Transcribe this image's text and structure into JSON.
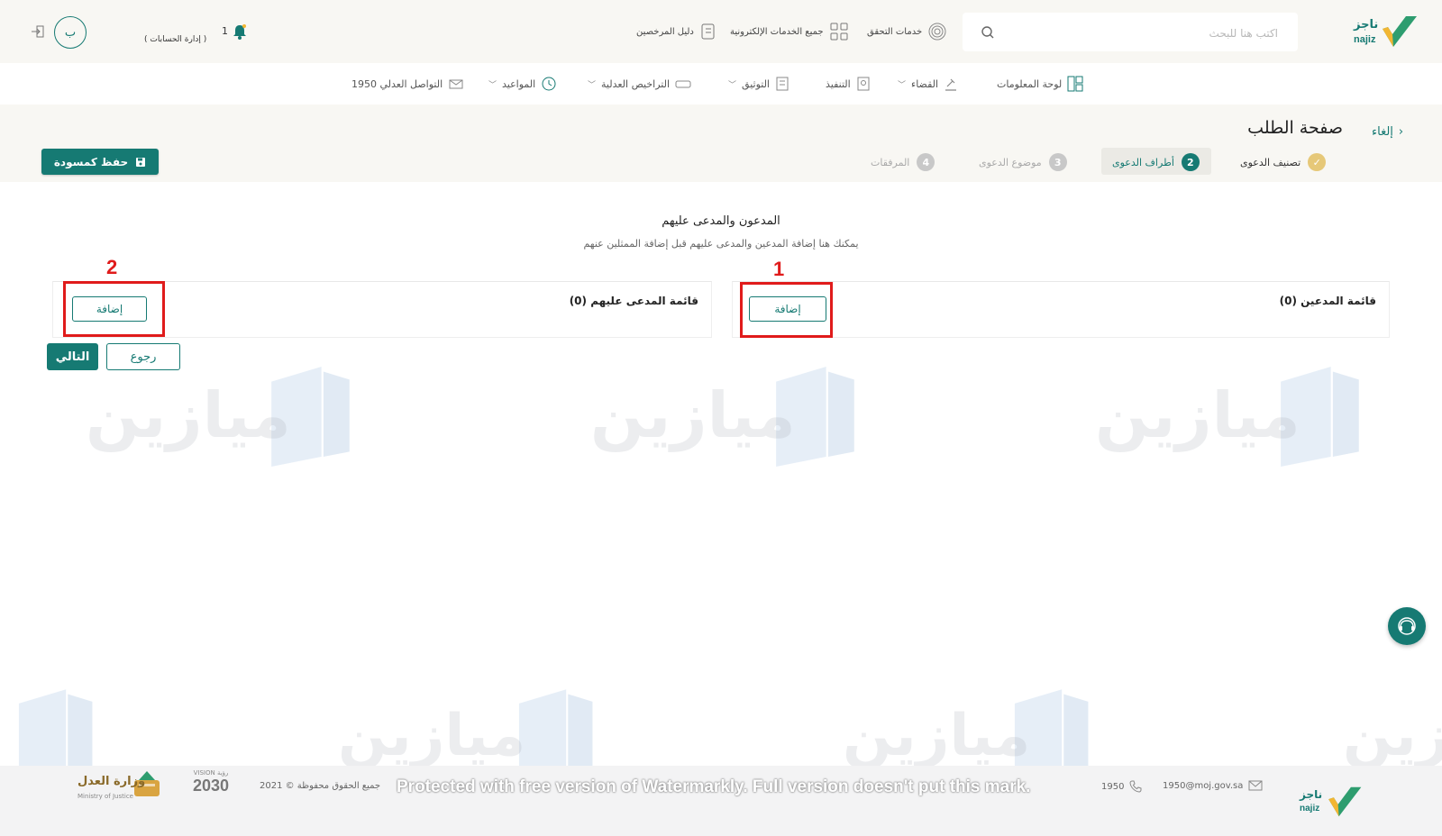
{
  "header": {
    "search_placeholder": "اكتب هنا للبحث",
    "links": [
      {
        "label": "خدمات التحقق",
        "icon": "fingerprint-icon"
      },
      {
        "label": "جميع الخدمات الإلكترونية",
        "icon": "grid-icon"
      },
      {
        "label": "دليل المرخصين",
        "icon": "book-icon"
      }
    ],
    "accounts_label": "( إدارة الحسابات )",
    "notification_count": "1",
    "avatar_initial": "ب",
    "brand": {
      "name": "ناجز",
      "sub": "najiz"
    }
  },
  "nav": [
    {
      "label": "لوحة المعلومات",
      "dropdown": false,
      "icon": "dashboard-icon"
    },
    {
      "label": "القضاء",
      "dropdown": true,
      "icon": "gavel-icon"
    },
    {
      "label": "التنفيذ",
      "dropdown": false,
      "icon": "execution-icon"
    },
    {
      "label": "التوثيق",
      "dropdown": true,
      "icon": "document-icon"
    },
    {
      "label": "التراخيص العدلية",
      "dropdown": true,
      "icon": "license-icon"
    },
    {
      "label": "المواعيد",
      "dropdown": true,
      "icon": "clock-icon"
    },
    {
      "label": "التواصل العدلي 1950",
      "dropdown": false,
      "icon": "envelope-icon"
    }
  ],
  "page": {
    "title": "صفحة الطلب",
    "cancel_label": "إلغاء",
    "save_draft_label": "حفظ كمسودة"
  },
  "steps": [
    {
      "num": "✓",
      "label": "تصنيف الدعوى",
      "state": "done"
    },
    {
      "num": "2",
      "label": "أطراف الدعوى",
      "state": "active"
    },
    {
      "num": "3",
      "label": "موضوع الدعوى",
      "state": "pending"
    },
    {
      "num": "4",
      "label": "المرفقات",
      "state": "pending"
    }
  ],
  "section": {
    "title": "المدعون والمدعى عليهم",
    "subtitle": "يمكنك هنا إضافة المدعين والمدعى عليهم قبل إضافة الممثلين عنهم"
  },
  "plaintiffs": {
    "title": "قائمة المدعين (0)",
    "add_label": "إضافة"
  },
  "defendants": {
    "title": "قائمة المدعى عليهم (0)",
    "add_label": "إضافة"
  },
  "annotations": {
    "box1": "1",
    "box2": "2"
  },
  "actions": {
    "next_label": "التالي",
    "back_label": "رجوع"
  },
  "watermark": {
    "text": "ميازين"
  },
  "footer": {
    "email": "1950@moj.gov.sa",
    "phone": "1950",
    "rights": "جميع الحقوق محفوظة © 2021",
    "vision_label": "VISION رؤية",
    "vision_year": "2030",
    "ministry_ar": "وزارة العدل",
    "ministry_en": "Ministry of Justice",
    "notice": "Protected with free version of Watermarkly. Full version doesn't put this mark."
  },
  "colors": {
    "brand_teal": "#167a73",
    "brand_green": "#2e9d6f",
    "brand_yellow": "#f2b632",
    "annotation_red": "#e01b1b",
    "header_bg": "#f8f7f3"
  }
}
